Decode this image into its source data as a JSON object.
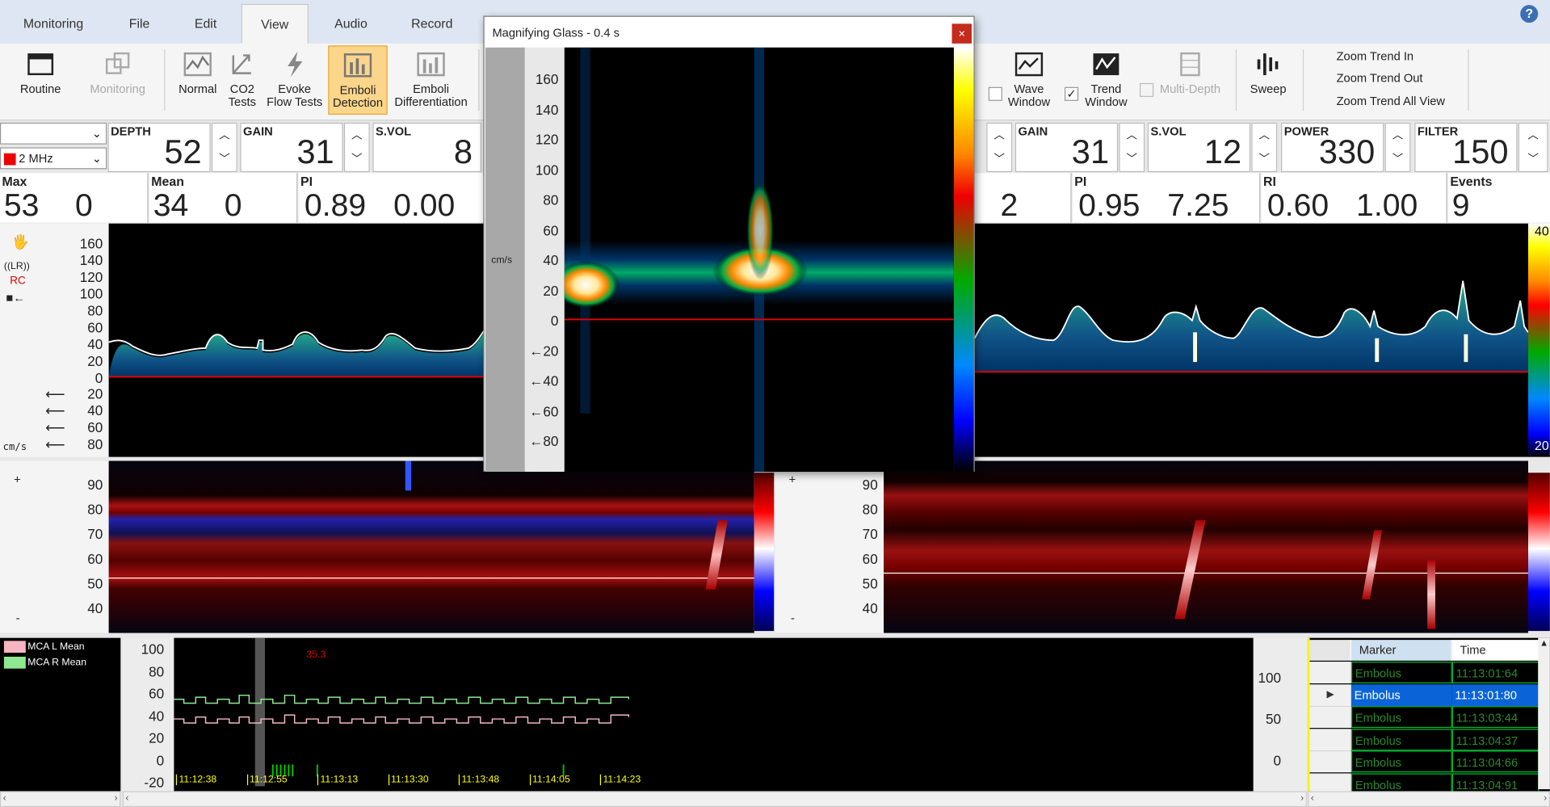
{
  "tabs": [
    "Monitoring",
    "File",
    "Edit",
    "View",
    "Audio",
    "Record"
  ],
  "active_tab": "View",
  "help_label": "?",
  "ribbon": {
    "routine": "Routine",
    "monitoring": "Monitoring",
    "normal": "Normal",
    "co2_line1": "CO2",
    "co2_line2": "Tests",
    "evoke_line1": "Evoke",
    "evoke_line2": "Flow Tests",
    "emboli_det_line1": "Emboli",
    "emboli_det_line2": "Detection",
    "emboli_diff_line1": "Emboli",
    "emboli_diff_line2": "Differentiation",
    "wave_line1": "Wave",
    "wave_line2": "Window",
    "trend_line1": "Trend",
    "trend_line2": "Window",
    "multi_depth": "Multi-Depth",
    "sweep": "Sweep",
    "zoom_in": "Zoom Trend In",
    "zoom_out": "Zoom Trend Out",
    "zoom_all": "Zoom Trend All View",
    "trend_checked": true,
    "wave_checked": false
  },
  "left_params": {
    "probe_freq": "2 MHz",
    "depth_label": "DEPTH",
    "depth": "52",
    "gain_label": "GAIN",
    "gain": "31",
    "svol_label": "S.VOL",
    "svol": "8"
  },
  "right_params": {
    "gain_label": "GAIN",
    "gain": "31",
    "svol_label": "S.VOL",
    "svol": "12",
    "power_label": "POWER",
    "power": "330",
    "filter_label": "FILTER",
    "filter": "150"
  },
  "left_stats": {
    "max_label": "Max",
    "max1": "53",
    "max2": "0",
    "mean_label": "Mean",
    "mean1": "34",
    "mean2": "0",
    "pi_label": "PI",
    "pi1": "0.89",
    "pi2": "0.00"
  },
  "right_stats": {
    "partial": "2",
    "pi_label": "PI",
    "pi1": "0.95",
    "pi2": "7.25",
    "ri_label": "RI",
    "ri1": "0.60",
    "ri2": "1.00",
    "events_label": "Events",
    "events": "9"
  },
  "left_spectrum": {
    "side_labels": [
      "((LR))",
      "RC"
    ],
    "unit": "cm/s",
    "ticks_pos": [
      "160",
      "140",
      "120",
      "100",
      "80",
      "60",
      "40",
      "20",
      "0"
    ],
    "ticks_neg": [
      "20",
      "40",
      "60",
      "80"
    ]
  },
  "right_colorbar": {
    "top": "40",
    "bottom": "20"
  },
  "mmode": {
    "ticks": [
      "90",
      "80",
      "70",
      "60",
      "50",
      "40"
    ],
    "plus": "+",
    "minus": "-"
  },
  "magnifier": {
    "title": "Magnifying Glass - 0.4 s",
    "close": "×",
    "unit": "cm/s",
    "ticks": [
      "160",
      "140",
      "120",
      "100",
      "80",
      "60",
      "40",
      "20",
      "0",
      "20",
      "40",
      "60",
      "80"
    ]
  },
  "trend": {
    "legend": [
      {
        "name": "MCA L Mean",
        "color": "#f4b6c2"
      },
      {
        "name": "MCA R Mean",
        "color": "#8fe88f"
      }
    ],
    "yticks": [
      "100",
      "80",
      "60",
      "40",
      "20",
      "0",
      "-20"
    ],
    "value_label": "35.3",
    "times": [
      "11:12:38",
      "11:12:55",
      "11:13:13",
      "11:13:30",
      "11:13:48",
      "11:14:05",
      "11:14:23"
    ],
    "right_ticks": [
      "100",
      "50",
      "0"
    ]
  },
  "events_table": {
    "col_marker": "Marker",
    "col_time": "Time",
    "rows": [
      {
        "marker": "Embolus",
        "time": "11:13:01:64",
        "selected": false
      },
      {
        "marker": "Embolus",
        "time": "11:13:01:80",
        "selected": true
      },
      {
        "marker": "Embolus",
        "time": "11:13:03:44",
        "selected": false
      },
      {
        "marker": "Embolus",
        "time": "11:13:04:37",
        "selected": false
      },
      {
        "marker": "Embolus",
        "time": "11:13:04:66",
        "selected": false
      },
      {
        "marker": "Embolus",
        "time": "11:13:04:91",
        "selected": false
      }
    ]
  }
}
